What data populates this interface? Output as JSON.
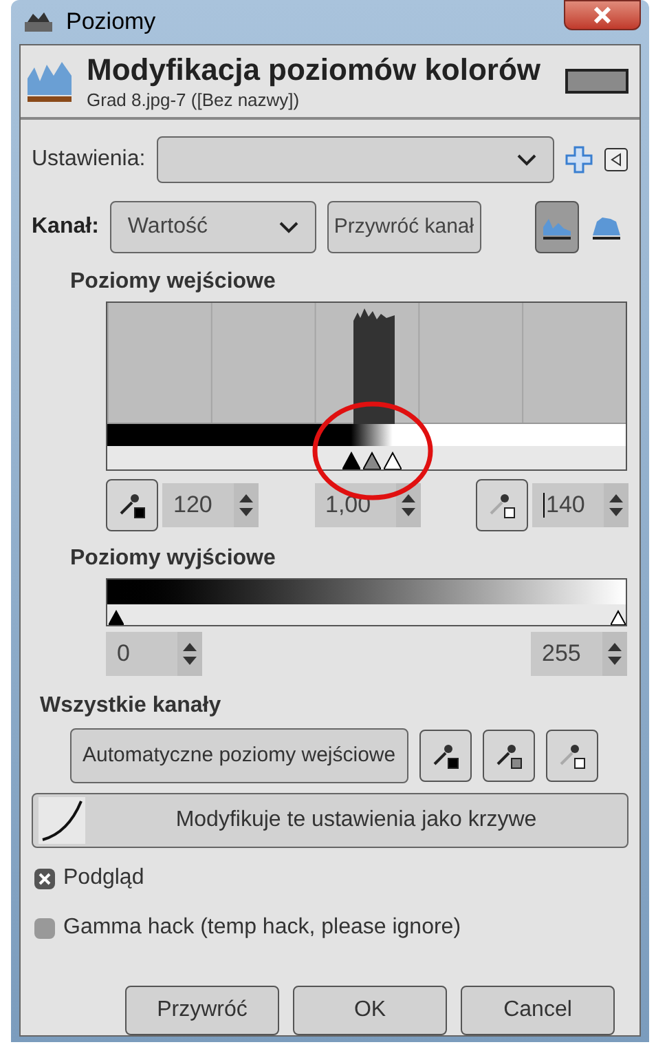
{
  "window": {
    "title": "Poziomy"
  },
  "header": {
    "title": "Modyfikacja poziomów kolorów",
    "subtitle": "Grad 8.jpg-7 ([Bez nazwy])"
  },
  "settings": {
    "label": "Ustawienia:"
  },
  "channel": {
    "label": "Kanał:",
    "value": "Wartość",
    "reset_button": "Przywróć kanał",
    "scale_modes": [
      {
        "kind": "linear",
        "selected": true
      },
      {
        "kind": "log",
        "selected": false
      }
    ]
  },
  "input_levels": {
    "title": "Poziomy wejściowe",
    "markers": [
      {
        "kind": "black",
        "level": 0.47
      },
      {
        "kind": "gray",
        "level": 0.51
      },
      {
        "kind": "white",
        "level": 0.55
      }
    ],
    "low": "120",
    "gamma": "1,00",
    "high": "140"
  },
  "output_levels": {
    "title": "Poziomy wyjściowe",
    "markers": [
      {
        "kind": "black",
        "level": 0
      },
      {
        "kind": "white",
        "level": 1
      }
    ],
    "low": "0",
    "high": "255"
  },
  "all_channels": {
    "title": "Wszystkie kanały",
    "auto_button": "Automatyczne poziomy wejściowe",
    "pickers": [
      {
        "kind": "black"
      },
      {
        "kind": "gray"
      },
      {
        "kind": "white"
      }
    ],
    "curves_button": "Modyfikuje te ustawienia jako krzywe"
  },
  "options": [
    {
      "label": "Podgląd",
      "checked": true
    },
    {
      "label": "Gamma hack (temp hack, please ignore)",
      "checked": false
    }
  ],
  "buttons": [
    "Przywróć",
    "OK",
    "Cancel"
  ]
}
